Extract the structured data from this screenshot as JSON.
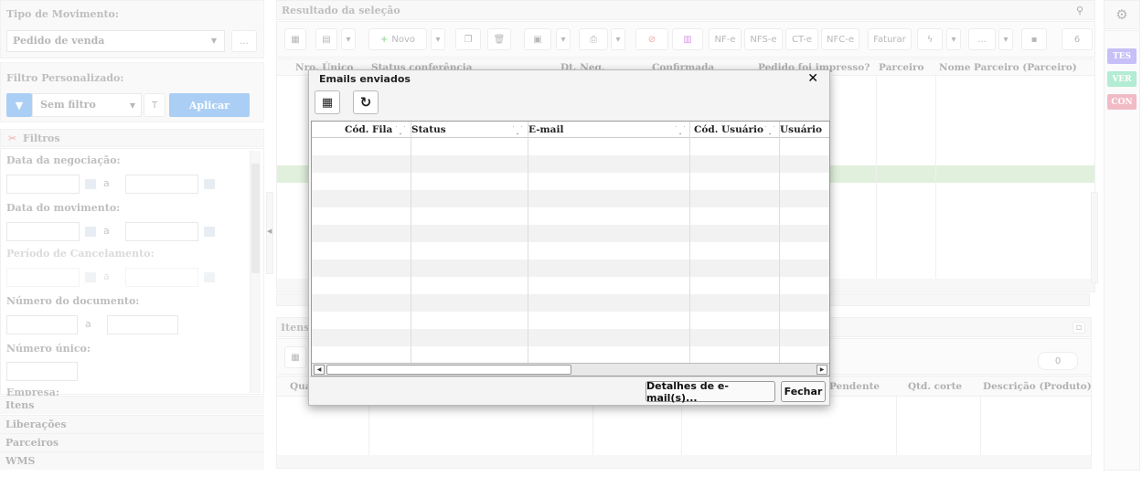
{
  "left_panel": {
    "tipo_movimento_label": "Tipo de Movimento:",
    "tipo_movimento_value": "Pedido de venda",
    "ellipsis": "...",
    "filtro_personalizado_label": "Filtro Personalizado:",
    "filtro_value": "Sem filtro",
    "aplicar": "Aplicar",
    "filtros_header": "Filtros",
    "data_negociacao": "Data da negociação:",
    "data_movimento": "Data do movimento:",
    "periodo_cancelamento": "Período de Cancelamento:",
    "numero_documento": "Número do documento:",
    "numero_unico": "Número único:",
    "empresa": "Empresa:",
    "a": "a",
    "accordion": [
      "Itens",
      "Liberações",
      "Parceiros",
      "WMS"
    ]
  },
  "main": {
    "result_title": "Resultado da seleção",
    "toolbar": {
      "novo": "Novo",
      "nfe": "NF-e",
      "nfse": "NFS-e",
      "cte": "CT-e",
      "nfce": "NFC-e",
      "faturar": "Faturar",
      "more": "...",
      "count": "6"
    },
    "columns": [
      "Nro. Único",
      "Status conferência",
      "Dt. Neg.",
      "Confirmada",
      "Pedido foi impresso?",
      "Parceiro",
      "Nome Parceiro (Parceiro)"
    ],
    "itens_title": "Itens",
    "itens_count": "0",
    "itens_columns": [
      "Qua",
      "Pendente",
      "Qtd. corte",
      "Descrição (Produto)"
    ]
  },
  "right_panel": {
    "tags": [
      "TES",
      "VER",
      "CON"
    ],
    "colors": {
      "tes": "#7b68ee",
      "ver": "#4cd39a",
      "con": "#e0607a"
    }
  },
  "dialog": {
    "title": "Emails enviados",
    "columns": [
      "Cód. Fila",
      "Status",
      "E-mail",
      "Cód. Usuário",
      "Usuário"
    ],
    "detalhes_button": "Detalhes de e-mail(s)...",
    "fechar_button": "Fechar",
    "close_glyph": "✕"
  }
}
